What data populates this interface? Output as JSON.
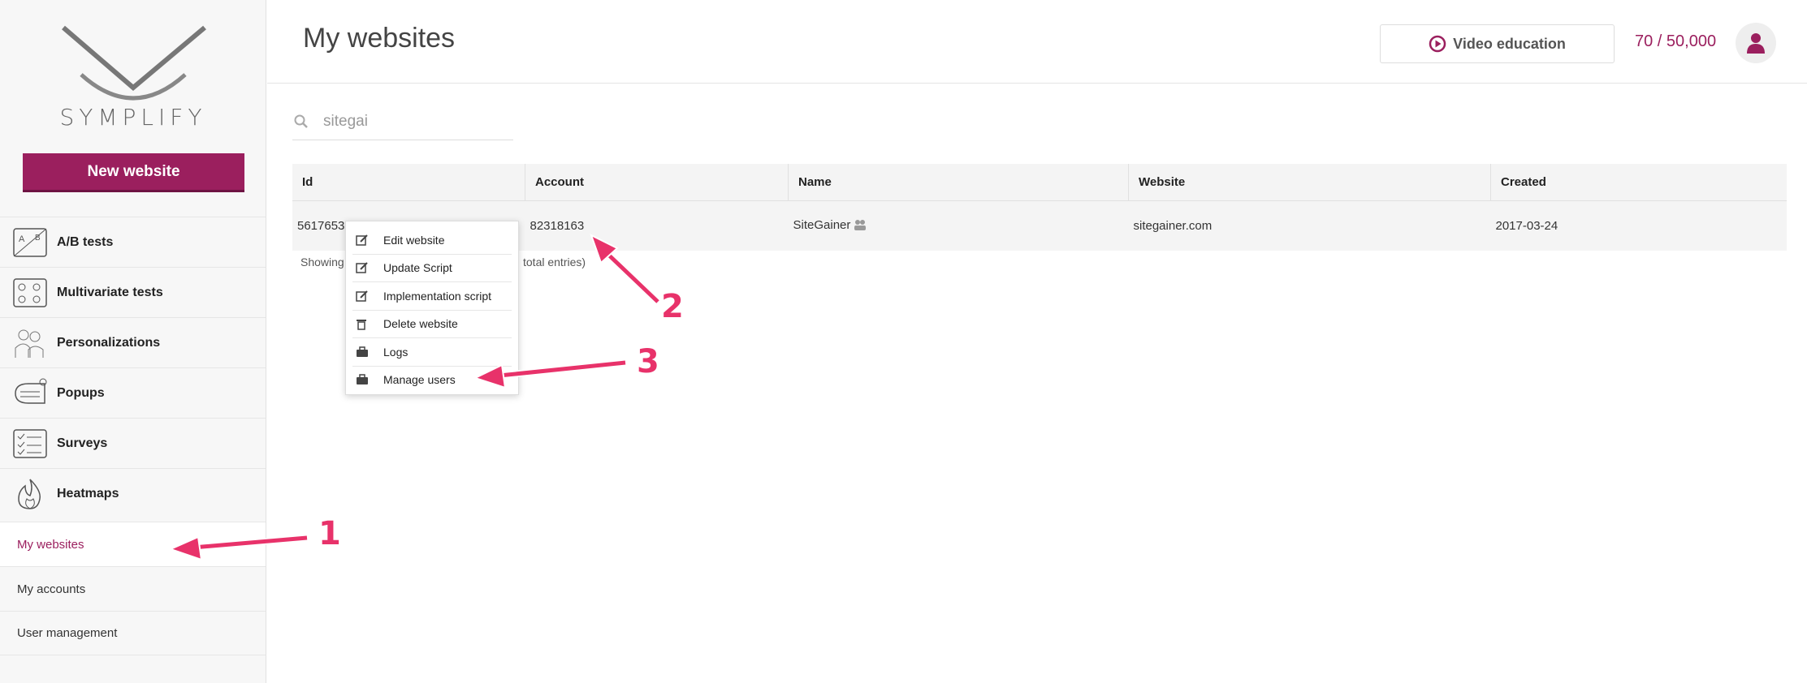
{
  "app": {
    "brand": "SYMPLIFY",
    "new_website_label": "New website"
  },
  "sidebar": {
    "items": [
      {
        "label": "A/B tests",
        "icon": "ab-test-icon"
      },
      {
        "label": "Multivariate tests",
        "icon": "multivariate-icon"
      },
      {
        "label": "Personalizations",
        "icon": "people-icon"
      },
      {
        "label": "Popups",
        "icon": "popup-icon"
      },
      {
        "label": "Surveys",
        "icon": "survey-icon"
      },
      {
        "label": "Heatmaps",
        "icon": "flame-icon"
      }
    ],
    "sub_items": [
      {
        "label": "My websites",
        "active": true
      },
      {
        "label": "My accounts",
        "active": false
      },
      {
        "label": "User management",
        "active": false
      }
    ]
  },
  "header": {
    "title": "My websites",
    "video_label": "Video education",
    "counter": "70 / 50,000"
  },
  "search": {
    "value": "sitegai"
  },
  "table": {
    "columns": [
      "Id",
      "Account",
      "Name",
      "Website",
      "Created"
    ],
    "rows": [
      {
        "id": "5617653",
        "account": "82318163",
        "name": "SiteGainer",
        "website": "sitegainer.com",
        "created": "2017-03-24"
      }
    ]
  },
  "showing": {
    "left": "Showing",
    "right": "total entries)"
  },
  "context_menu": {
    "items": [
      {
        "label": "Edit website",
        "icon": "edit-icon"
      },
      {
        "label": "Update Script",
        "icon": "edit-icon"
      },
      {
        "label": "Implementation script",
        "icon": "edit-icon"
      },
      {
        "label": "Delete website",
        "icon": "trash-icon"
      },
      {
        "label": "Logs",
        "icon": "briefcase-icon"
      },
      {
        "label": "Manage users",
        "icon": "briefcase-icon"
      }
    ]
  },
  "annotations": {
    "one": "1",
    "two": "2",
    "three": "3"
  },
  "colors": {
    "brand": "#9b1f5e",
    "annotation": "#e8326a"
  }
}
